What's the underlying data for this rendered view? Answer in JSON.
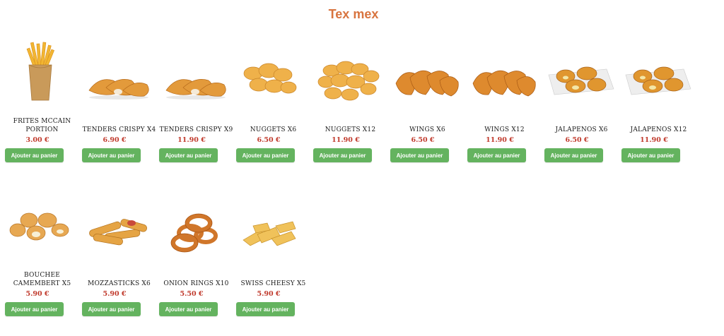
{
  "page": {
    "title": "Tex mex"
  },
  "products": [
    {
      "name": "FRITES MCCAIN PORTION",
      "price": "3.00 €",
      "button": "Ajouter au panier",
      "icon": "fries-icon"
    },
    {
      "name": "TENDERS CRISPY X4",
      "price": "6.90 €",
      "button": "Ajouter au panier",
      "icon": "tenders-icon"
    },
    {
      "name": "TENDERS CRISPY X9",
      "price": "11.90 €",
      "button": "Ajouter au panier",
      "icon": "tenders-icon"
    },
    {
      "name": "NUGGETS X6",
      "price": "6.50 €",
      "button": "Ajouter au panier",
      "icon": "nuggets-icon"
    },
    {
      "name": "NUGGETS X12",
      "price": "11.90 €",
      "button": "Ajouter au panier",
      "icon": "nuggets-icon"
    },
    {
      "name": "WINGS X6",
      "price": "6.50 €",
      "button": "Ajouter au panier",
      "icon": "wings-icon"
    },
    {
      "name": "WINGS X12",
      "price": "11.90 €",
      "button": "Ajouter au panier",
      "icon": "wings-icon"
    },
    {
      "name": "JALAPENOS X6",
      "price": "6.50 €",
      "button": "Ajouter au panier",
      "icon": "jalapenos-icon"
    },
    {
      "name": "JALAPENOS X12",
      "price": "11.90 €",
      "button": "Ajouter au panier",
      "icon": "jalapenos-icon"
    },
    {
      "name": "BOUCHEE CAMEMBERT X5",
      "price": "5.90 €",
      "button": "Ajouter au panier",
      "icon": "camembert-bites-icon"
    },
    {
      "name": "MOZZASTICKS X6",
      "price": "5.90 €",
      "button": "Ajouter au panier",
      "icon": "mozzasticks-icon"
    },
    {
      "name": "ONION RINGS X10",
      "price": "5.50 €",
      "button": "Ajouter au panier",
      "icon": "onion-rings-icon"
    },
    {
      "name": "SWISS CHEESY X5",
      "price": "5.90 €",
      "button": "Ajouter au panier",
      "icon": "swiss-cheesy-icon"
    }
  ],
  "colors": {
    "title": "#d8743f",
    "price": "#c0392b",
    "button": "#64b35f"
  }
}
